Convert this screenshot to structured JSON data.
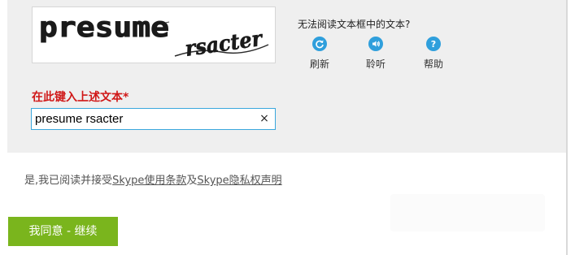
{
  "captcha": {
    "image_text_line1": "presume",
    "image_text_line2": "rsacter"
  },
  "help": {
    "title": "无法阅读文本框中的文本?",
    "actions": [
      {
        "label": "刷新",
        "icon": "refresh-icon"
      },
      {
        "label": "聆听",
        "icon": "speaker-icon"
      },
      {
        "label": "帮助",
        "icon": "question-icon"
      }
    ]
  },
  "form": {
    "label": "在此键入上述文本*",
    "input_value": "presume rsacter",
    "clear_glyph": "×"
  },
  "terms": {
    "prefix": "是,我已阅读并接受",
    "link1": "Skype使用条款",
    "middle": "及",
    "link2": "Skype隐私权声明"
  },
  "agree_button": "我同意 - 继续",
  "colors": {
    "panel_bg": "#efefef",
    "icon_blue": "#2f9fdc",
    "required_red": "#d01818",
    "button_green": "#7ab51d",
    "input_border": "#3aa7dd"
  }
}
